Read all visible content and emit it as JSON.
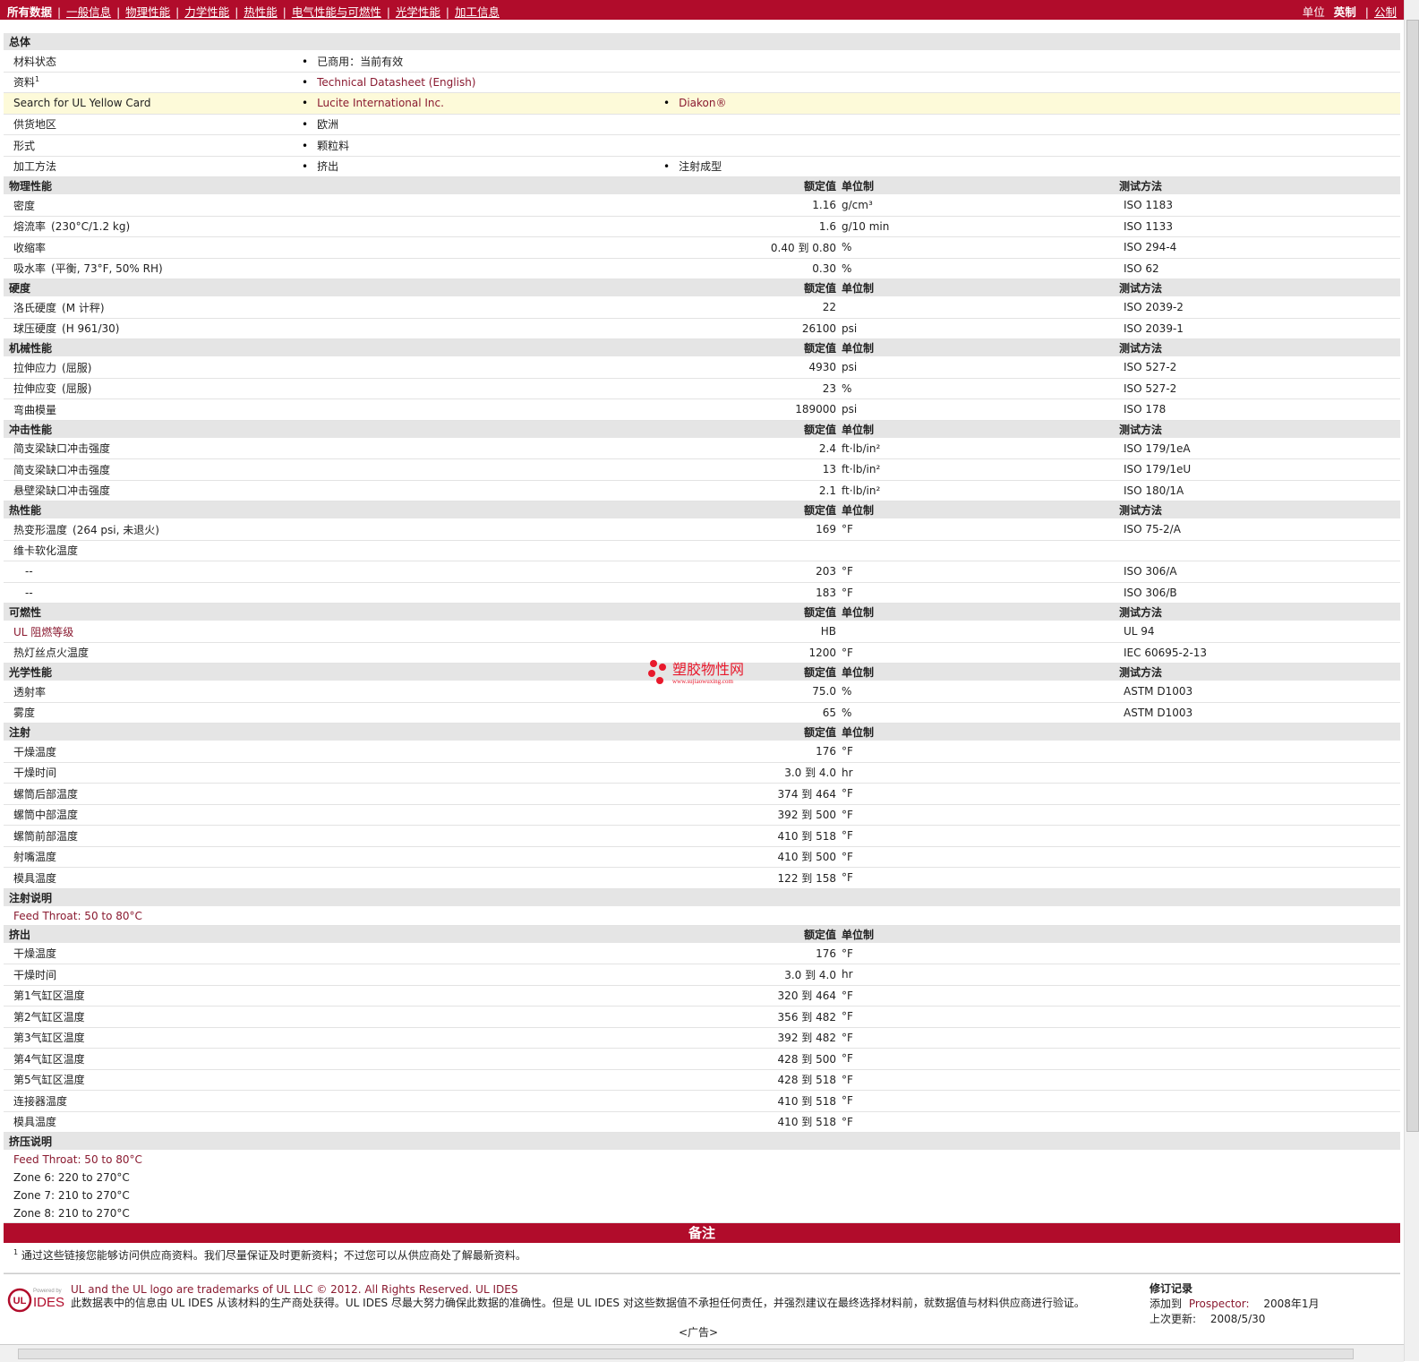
{
  "nav": {
    "tabs": [
      "所有数据",
      "一般信息",
      "物理性能",
      "力学性能",
      "热性能",
      "电气性能与可燃性",
      "光学性能",
      "加工信息"
    ],
    "units_label": "单位",
    "units_selected": "英制",
    "units_other": "公制"
  },
  "general": {
    "title": "总体",
    "rows": [
      {
        "label": "材料状态",
        "v1": "已商用：当前有效",
        "v2": ""
      },
      {
        "label": "资料",
        "sup": "1",
        "v1": "Technical Datasheet (English)",
        "v2": ""
      },
      {
        "label": "Search for UL Yellow Card",
        "v1": "Lucite International Inc.",
        "v2": "Diakon®"
      },
      {
        "label": "供货地区",
        "v1": "欧洲",
        "v2": ""
      },
      {
        "label": "形式",
        "v1": "颗粒料",
        "v2": ""
      },
      {
        "label": "加工方法",
        "v1": "挤出",
        "v2": "注射成型"
      }
    ]
  },
  "col_headers": {
    "nominal": "额定值",
    "unit": "单位制",
    "test": "测试方法"
  },
  "sections": [
    {
      "title": "物理性能",
      "has_test": true,
      "rows": [
        {
          "label": "密度",
          "cond": "",
          "value": "1.16",
          "unit": "g/cm³",
          "test": "ISO 1183"
        },
        {
          "label": "熔流率",
          "cond": "(230°C/1.2 kg)",
          "value": "1.6",
          "unit": "g/10 min",
          "test": "ISO 1133"
        },
        {
          "label": "收缩率",
          "cond": "",
          "value": "0.40 到  0.80",
          "unit": "%",
          "test": "ISO 294-4"
        },
        {
          "label": "吸水率",
          "cond": "(平衡, 73°F, 50% RH)",
          "value": "0.30",
          "unit": "%",
          "test": "ISO 62"
        }
      ]
    },
    {
      "title": "硬度",
      "has_test": true,
      "rows": [
        {
          "label": "洛氏硬度",
          "cond": "(M 计秤)",
          "value": "22",
          "unit": "",
          "test": "ISO 2039-2"
        },
        {
          "label": "球压硬度",
          "cond": "(H 961/30)",
          "value": "26100",
          "unit": "psi",
          "test": "ISO 2039-1"
        }
      ]
    },
    {
      "title": "机械性能",
      "has_test": true,
      "rows": [
        {
          "label": "拉伸应力",
          "cond": "(屈服)",
          "value": "4930",
          "unit": "psi",
          "test": "ISO 527-2"
        },
        {
          "label": "拉伸应变",
          "cond": "(屈服)",
          "value": "23",
          "unit": "%",
          "test": "ISO 527-2"
        },
        {
          "label": "弯曲模量",
          "cond": "",
          "value": "189000",
          "unit": "psi",
          "test": "ISO 178"
        }
      ]
    },
    {
      "title": "冲击性能",
      "has_test": true,
      "rows": [
        {
          "label": "简支梁缺口冲击强度",
          "cond": "",
          "value": "2.4",
          "unit": "ft·lb/in²",
          "test": "ISO 179/1eA"
        },
        {
          "label": "简支梁缺口冲击强度",
          "cond": "",
          "value": "13",
          "unit": "ft·lb/in²",
          "test": "ISO 179/1eU"
        },
        {
          "label": "悬壁梁缺口冲击强度",
          "cond": "",
          "value": "2.1",
          "unit": "ft·lb/in²",
          "test": "ISO 180/1A"
        }
      ]
    },
    {
      "title": "热性能",
      "has_test": true,
      "rows": [
        {
          "label": "热变形温度",
          "cond": "(264 psi, 未退火)",
          "value": "169",
          "unit": "°F",
          "test": "ISO 75-2/A"
        },
        {
          "label": "维卡软化温度",
          "cond": "",
          "value": "",
          "unit": "",
          "test": ""
        },
        {
          "label": "--",
          "sub": true,
          "cond": "",
          "value": "203",
          "unit": "°F",
          "test": "ISO 306/A"
        },
        {
          "label": "--",
          "sub": true,
          "cond": "",
          "value": "183",
          "unit": "°F",
          "test": "ISO 306/B"
        }
      ]
    },
    {
      "title": "可燃性",
      "has_test": true,
      "rows": [
        {
          "label": "UL 阻燃等级",
          "link": true,
          "cond": "",
          "value": "HB",
          "unit": "",
          "test": "UL 94"
        },
        {
          "label": "热灯丝点火温度",
          "cond": "",
          "value": "1200",
          "unit": "°F",
          "test": "IEC 60695-2-13"
        }
      ]
    },
    {
      "title": "光学性能",
      "has_test": true,
      "rows": [
        {
          "label": "透射率",
          "cond": "",
          "value": "75.0",
          "unit": "%",
          "test": "ASTM D1003"
        },
        {
          "label": "雾度",
          "cond": "",
          "value": "65",
          "unit": "%",
          "test": "ASTM D1003"
        }
      ]
    },
    {
      "title": "注射",
      "has_test": false,
      "rows": [
        {
          "label": "干燥温度",
          "cond": "",
          "value": "176",
          "unit": "°F",
          "test": ""
        },
        {
          "label": "干燥时间",
          "cond": "",
          "value": "3.0 到  4.0",
          "unit": "hr",
          "test": ""
        },
        {
          "label": "螺筒后部温度",
          "cond": "",
          "value": "374 到  464",
          "unit": "°F",
          "test": ""
        },
        {
          "label": "螺筒中部温度",
          "cond": "",
          "value": "392 到  500",
          "unit": "°F",
          "test": ""
        },
        {
          "label": "螺筒前部温度",
          "cond": "",
          "value": "410 到  518",
          "unit": "°F",
          "test": ""
        },
        {
          "label": "射嘴温度",
          "cond": "",
          "value": "410 到  500",
          "unit": "°F",
          "test": ""
        },
        {
          "label": "模具温度",
          "cond": "",
          "value": "122 到  158",
          "unit": "°F",
          "test": ""
        }
      ]
    }
  ],
  "injection_notes": {
    "title": "注射说明",
    "lines": [
      "Feed Throat: 50 to 80°C"
    ]
  },
  "extrusion": {
    "title": "挤出",
    "rows": [
      {
        "label": "干燥温度",
        "value": "176",
        "unit": "°F"
      },
      {
        "label": "干燥时间",
        "value": "3.0 到  4.0",
        "unit": "hr"
      },
      {
        "label": "第1气缸区温度",
        "value": "320 到  464",
        "unit": "°F"
      },
      {
        "label": "第2气缸区温度",
        "value": "356 到  482",
        "unit": "°F"
      },
      {
        "label": "第3气缸区温度",
        "value": "392 到  482",
        "unit": "°F"
      },
      {
        "label": "第4气缸区温度",
        "value": "428 到  500",
        "unit": "°F"
      },
      {
        "label": "第5气缸区温度",
        "value": "428 到  518",
        "unit": "°F"
      },
      {
        "label": "连接器温度",
        "value": "410 到  518",
        "unit": "°F"
      },
      {
        "label": "模具温度",
        "value": "410 到  518",
        "unit": "°F"
      }
    ]
  },
  "extrusion_notes": {
    "title": "挤压说明",
    "lines": [
      "Feed Throat: 50 to 80°C",
      "Zone 6: 220 to 270°C",
      "Zone 7: 210 to 270°C",
      "Zone 8: 210 to 270°C"
    ]
  },
  "remarks": {
    "title": "备注",
    "sup": "1",
    "text": "通过这些链接您能够访问供应商资料。我们尽量保证及时更新资料；不过您可以从供应商处了解最新资料。"
  },
  "footer": {
    "logo_small": "Powered by",
    "logo_text": "IDES",
    "trademark": "UL and the UL logo are trademarks of UL LLC © 2012. All Rights Reserved. UL IDES",
    "disclaimer": "此数据表中的信息由 UL IDES 从该材料的生产商处获得。UL IDES 尽最大努力确保此数据的准确性。但是 UL IDES 对这些数据值不承担任何责任，并强烈建议在最终选择材料前，就数据值与材料供应商进行验证。",
    "rev_title": "修订记录",
    "added_label": "添加到",
    "added_prospector": "Prospector:",
    "added_date": "2008年1月",
    "updated_label": "上次更新:",
    "updated_date": "2008/5/30",
    "ad": "<广告>"
  },
  "watermark": {
    "text": "塑胶物性网",
    "url": "www.sujiaowuxing.com"
  },
  "colors": {
    "brand_red": "#b10c2b",
    "link": "#8a1a30",
    "header_gray": "#e5e5e5",
    "highlight": "#fdfad9"
  }
}
